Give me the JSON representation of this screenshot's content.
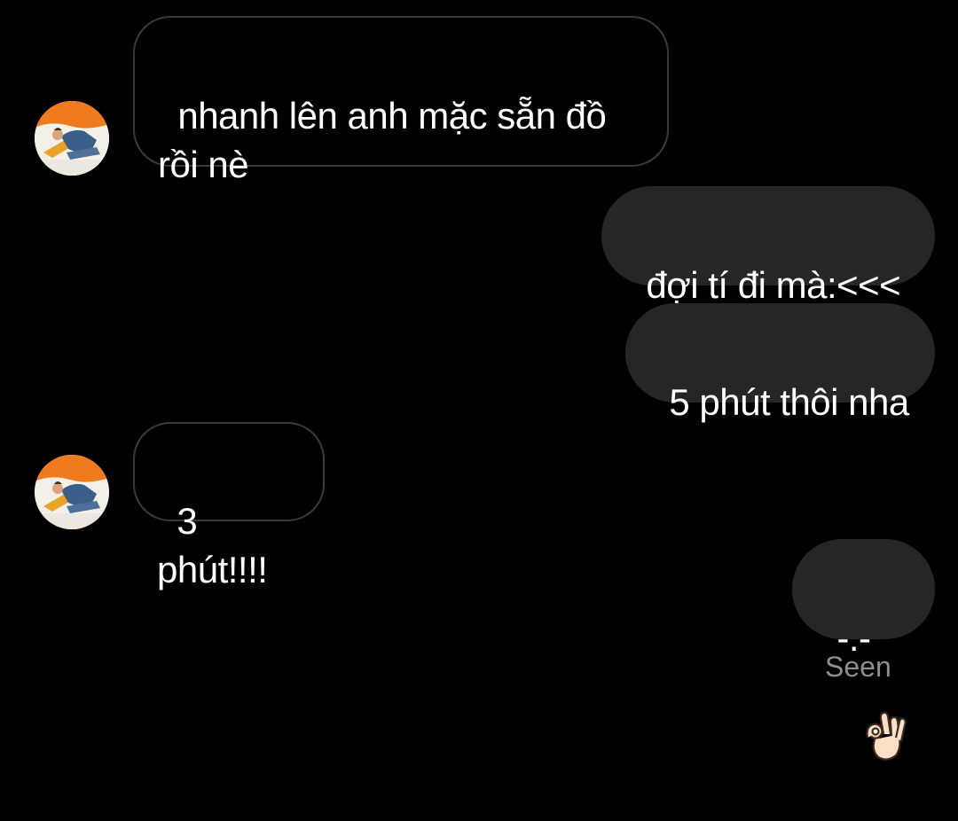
{
  "conversation": {
    "messages": [
      {
        "sender": "other",
        "text": "nhanh lên anh mặc sẵn đồ\nrồi nè"
      },
      {
        "sender": "me",
        "text": "đợi tí đi mà:<<<"
      },
      {
        "sender": "me",
        "text": "5 phút thôi nha"
      },
      {
        "sender": "other",
        "text": "3 phút!!!!"
      },
      {
        "sender": "me",
        "text": "-.-",
        "emoji": "ok-hand-emoji"
      }
    ],
    "status": "Seen"
  },
  "theme": {
    "background": "#000000",
    "sent_bubble": "#262626",
    "received_border": "#3a3a3a",
    "text": "#ffffff",
    "status_text": "#8e8e8e"
  }
}
